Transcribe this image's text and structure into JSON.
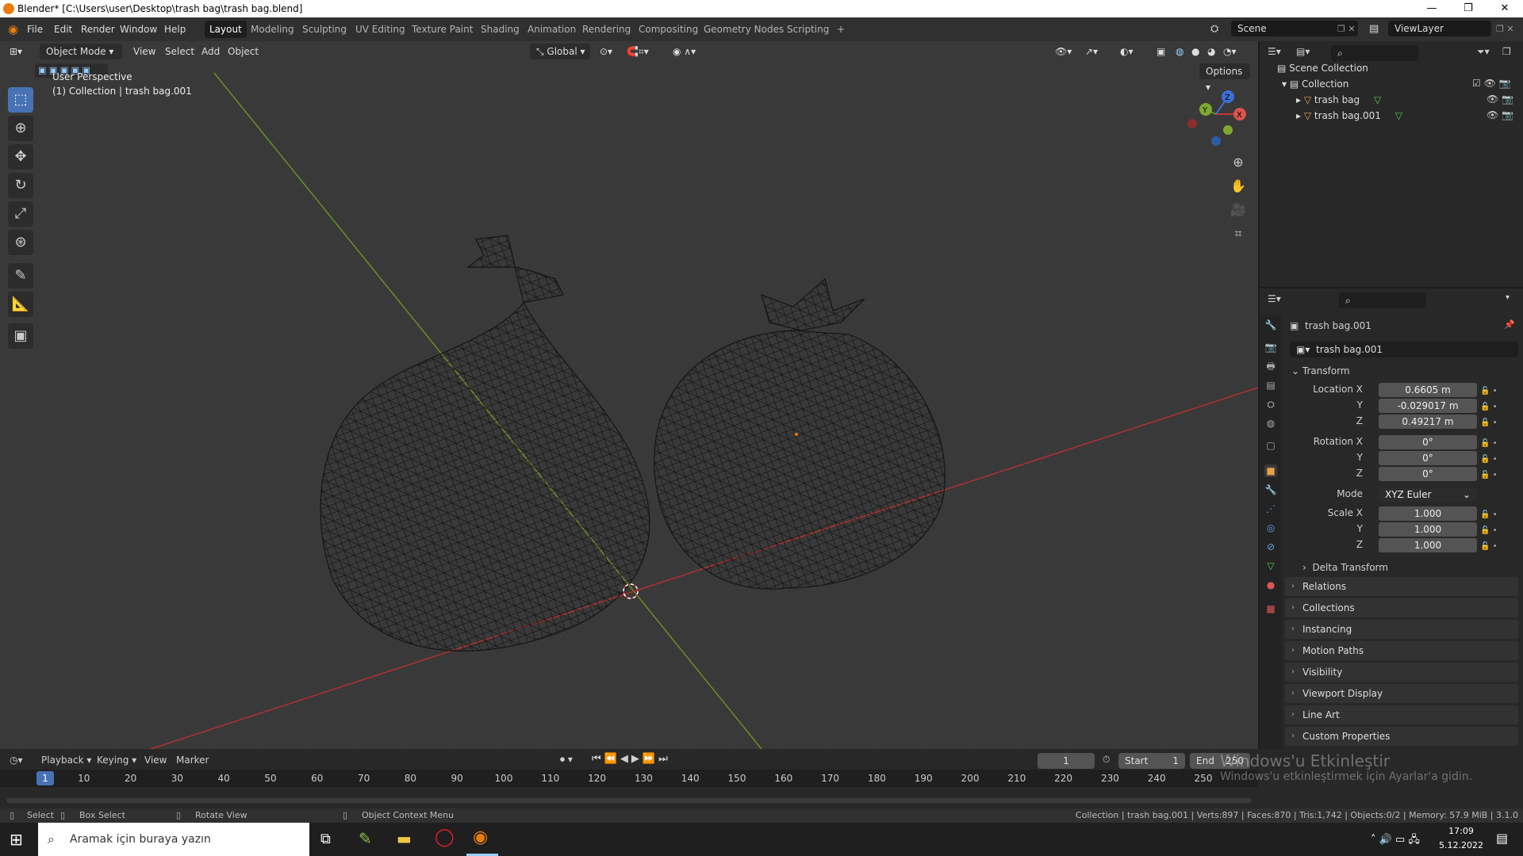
{
  "titlebar": {
    "title": "Blender* [C:\\Users\\user\\Desktop\\trash bag\\trash bag.blend]",
    "minimize": "—",
    "maximize": "❐",
    "close": "✕"
  },
  "menu": {
    "file": "File",
    "edit": "Edit",
    "render": "Render",
    "window": "Window",
    "help": "Help"
  },
  "workspaces": [
    "Layout",
    "Modeling",
    "Sculpting",
    "UV Editing",
    "Texture Paint",
    "Shading",
    "Animation",
    "Rendering",
    "Compositing",
    "Geometry Nodes",
    "Scripting",
    "+"
  ],
  "scene": {
    "scene_label": "Scene",
    "viewlayer_label": "ViewLayer"
  },
  "viewport": {
    "mode": "Object Mode",
    "menus": [
      "View",
      "Select",
      "Add",
      "Object"
    ],
    "orientation": "Global",
    "options": "Options",
    "overlay_title": "User Perspective",
    "overlay_sub": "(1) Collection | trash bag.001",
    "gizmo": {
      "x": "X",
      "y": "Y",
      "z": "Z"
    }
  },
  "outliner": {
    "scene_collection": "Scene Collection",
    "collection": "Collection",
    "items": [
      "trash bag",
      "trash bag.001"
    ]
  },
  "properties": {
    "object_name": "trash bag.001",
    "datablock": "trash bag.001",
    "transform_label": "Transform",
    "location_label": "Location X",
    "rotation_label": "Rotation X",
    "scale_label": "Scale X",
    "y_label": "Y",
    "z_label": "Z",
    "location": [
      "0.6605 m",
      "-0.029017 m",
      "0.49217 m"
    ],
    "rotation": [
      "0°",
      "0°",
      "0°"
    ],
    "mode_label": "Mode",
    "mode_value": "XYZ Euler",
    "scale": [
      "1.000",
      "1.000",
      "1.000"
    ],
    "delta": "Delta Transform",
    "panels": [
      "Relations",
      "Collections",
      "Instancing",
      "Motion Paths",
      "Visibility",
      "Viewport Display",
      "Line Art",
      "Custom Properties"
    ]
  },
  "timeline": {
    "menus": [
      "Playback",
      "Keying",
      "View",
      "Marker"
    ],
    "current_frame": "1",
    "start_label": "Start",
    "start": "1",
    "end_label": "End",
    "end": "250",
    "ticks": [
      "1",
      "10",
      "20",
      "30",
      "40",
      "50",
      "60",
      "70",
      "80",
      "90",
      "100",
      "110",
      "120",
      "130",
      "140",
      "150",
      "160",
      "170",
      "180",
      "190",
      "200",
      "210",
      "220",
      "230",
      "240",
      "250"
    ]
  },
  "watermark": {
    "line1": "Windows'u Etkinleştir",
    "line2": "Windows'u etkinleştirmek için Ayarlar'a gidin."
  },
  "statusbar": {
    "select": "Select",
    "box_select": "Box Select",
    "rotate": "Rotate View",
    "context": "Object Context Menu",
    "stats": "Collection | trash bag.001 | Verts:897 | Faces:870 | Tris:1,742 | Objects:0/2 | Memory: 57.9 MiB | 3.1.0"
  },
  "taskbar": {
    "search_placeholder": "Aramak için buraya yazın",
    "time": "17:09",
    "date": "5.12.2022"
  },
  "colors": {
    "accent": "#4772b3",
    "x_axis": "#b03030",
    "y_axis": "#6b8e23",
    "orange": "#e87d0d"
  }
}
